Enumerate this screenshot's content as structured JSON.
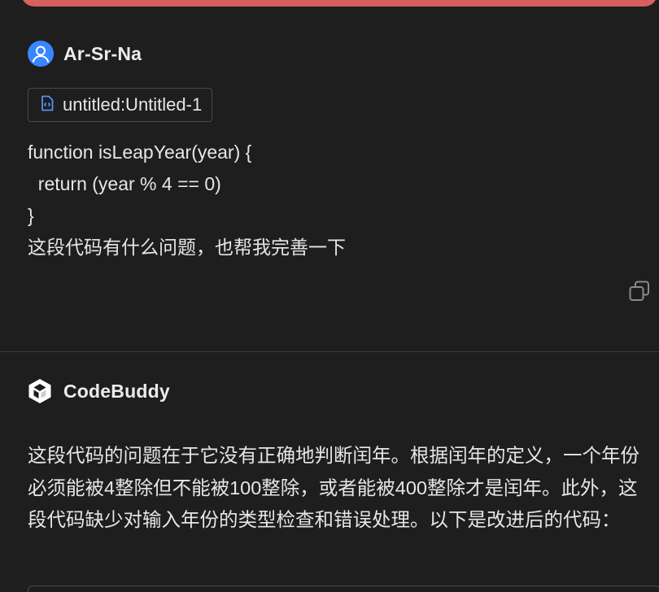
{
  "user": {
    "name": "Ar-Sr-Na",
    "avatar_icon": "user-avatar-icon",
    "avatar_color": "#3a86ff"
  },
  "attachment": {
    "label": "untitled:Untitled-1",
    "icon": "code-file-icon"
  },
  "message": {
    "code_lines": [
      "function isLeapYear(year) {",
      "  return (year % 4 == 0)",
      "}"
    ],
    "question": "这段代码有什么问题，也帮我完善一下"
  },
  "assistant": {
    "name": "CodeBuddy",
    "answer": "这段代码的问题在于它没有正确地判断闰年。根据闰年的定义，一个年份必须能被4整除但不能被100整除，或者能被400整除才是闰年。此外，这段代码缺少对输入年份的类型检查和错误处理。以下是改进后的代码："
  },
  "colors": {
    "background": "#1e1e1e",
    "top_banner": "#d6605f",
    "text": "#e6e6e6",
    "divider": "#3c3c3c"
  }
}
